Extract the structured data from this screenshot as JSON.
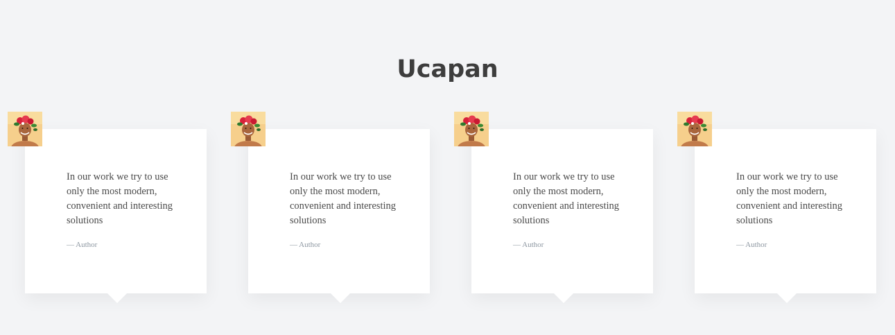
{
  "section": {
    "title": "Ucapan"
  },
  "testimonials": [
    {
      "quote": "In our work we try to use only the most modern, convenient and interesting solutions",
      "author": "— Author",
      "avatar_icon": "person-with-flowers-avatar"
    },
    {
      "quote": "In our work we try to use only the most modern, convenient and interesting solutions",
      "author": "— Author",
      "avatar_icon": "person-with-flowers-avatar"
    },
    {
      "quote": "In our work we try to use only the most modern, convenient and interesting solutions",
      "author": "— Author",
      "avatar_icon": "person-with-flowers-avatar"
    },
    {
      "quote": "In our work we try to use only the most modern, convenient and interesting solutions",
      "author": "— Author",
      "avatar_icon": "person-with-flowers-avatar"
    }
  ],
  "colors": {
    "background": "#f3f4f6",
    "card": "#ffffff",
    "title": "#3d3d3d",
    "quote_text": "#4a4a4a",
    "author_text": "#8c96a0"
  }
}
